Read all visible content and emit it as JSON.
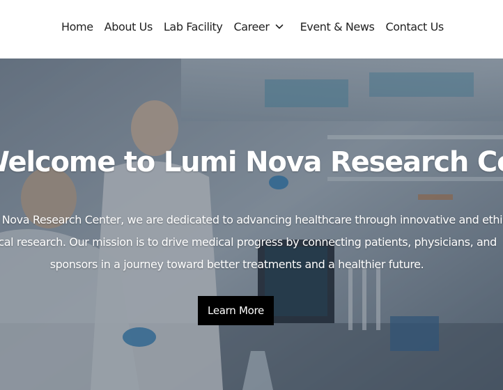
{
  "nav": {
    "items": [
      {
        "label": "Home"
      },
      {
        "label": "About Us"
      },
      {
        "label": "Lab Facility"
      },
      {
        "label": "Career",
        "has_dropdown": true,
        "icon": "chevron-down-icon"
      },
      {
        "label": "Event & News"
      },
      {
        "label": "Contact Us"
      }
    ]
  },
  "hero": {
    "title": "Welcome to Lumi Nova Research Center",
    "lines": [
      "At Lumi Nova Research Center, we are dedicated to advancing healthcare through innovative and ethical",
      "clinical research. Our mission is to drive medical progress by connecting patients, physicians, and",
      "sponsors in a journey toward better treatments and a healthier future."
    ],
    "button_label": "Learn More"
  },
  "colors": {
    "header_bg": "#ffffff",
    "nav_text": "#222222",
    "hero_text": "#ffffff",
    "button_bg": "#000000"
  }
}
